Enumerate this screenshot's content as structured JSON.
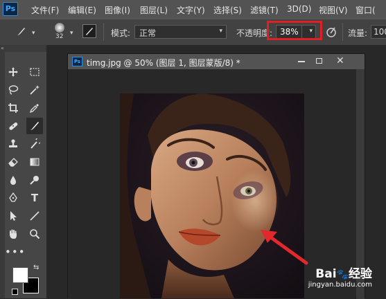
{
  "app": {
    "logo": "Ps"
  },
  "menu": [
    "文件(F)",
    "编辑(E)",
    "图像(I)",
    "图层(L)",
    "文字(Y)",
    "选择(S)",
    "滤镜(T)",
    "3D(D)",
    "视图(V)",
    "窗口("
  ],
  "options": {
    "brush_size": "32",
    "mode_label": "模式:",
    "mode_value": "正常",
    "opacity_label": "不透明度:",
    "opacity_value": "38%",
    "flow_label": "流量:",
    "flow_value": "100"
  },
  "document": {
    "title": "timg.jpg @ 50% (图层 1, 图层蒙版/8) *",
    "icon": "Ps"
  },
  "watermark": {
    "brand": "Bai",
    "brand2": "经验",
    "url": "jingyan.baidu.com"
  },
  "colors": {
    "highlight": "#e01e24",
    "arrow": "#e0282d",
    "foreground": "#ffffff",
    "background": "#000000"
  }
}
